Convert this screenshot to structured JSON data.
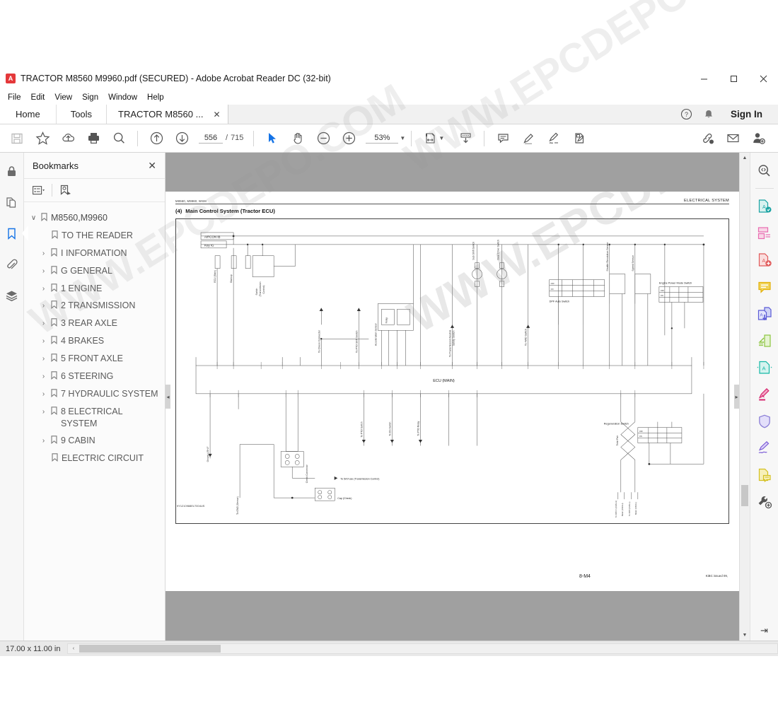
{
  "window": {
    "title": "TRACTOR M8560 M9960.pdf (SECURED) - Adobe Acrobat Reader DC (32-bit)",
    "app_badge": "A",
    "minimize": "–",
    "maximize": "☐",
    "close": "✕"
  },
  "menu": {
    "items": [
      "File",
      "Edit",
      "View",
      "Sign",
      "Window",
      "Help"
    ]
  },
  "tabs": {
    "home": "Home",
    "tools": "Tools",
    "document": "TRACTOR M8560 ...",
    "close_glyph": "✕",
    "help_icon": "help-circle-icon",
    "bell_icon": "bell-icon",
    "sign_in": "Sign In"
  },
  "toolbar": {
    "save_label": "save-icon",
    "star_label": "add-to-favorites-icon",
    "upload_label": "upload-cloud-icon",
    "print_label": "print-icon",
    "find_label": "find-icon",
    "prev_page": "previous-page-icon",
    "next_page": "next-page-icon",
    "page_current": "556",
    "page_sep": "/",
    "page_total": "715",
    "select_tool": "select-cursor-icon",
    "hand_tool": "hand-icon",
    "zoom_out": "zoom-out-icon",
    "zoom_in": "zoom-in-icon",
    "zoom_value": "53%",
    "zoom_caret": "▼",
    "fit_page": "fit-page-icon",
    "fit_caret": "▼",
    "scroll_mode": "scroll-mode-icon",
    "comment": "comment-icon",
    "highlight": "highlight-icon",
    "sign": "sign-icon",
    "fill_sign": "fill-and-sign-icon",
    "share_link": "share-link-icon",
    "email": "email-icon",
    "add_person": "add-person-icon"
  },
  "left_rail": {
    "items": [
      {
        "name": "security-lock-icon",
        "label": "Security"
      },
      {
        "name": "page-thumbnails-icon",
        "label": "Page Thumbnails"
      },
      {
        "name": "bookmarks-icon",
        "label": "Bookmarks",
        "active": true
      },
      {
        "name": "attachments-paperclip-icon",
        "label": "Attachments"
      },
      {
        "name": "layers-icon",
        "label": "Layers"
      }
    ]
  },
  "bookmarks_panel": {
    "title": "Bookmarks",
    "close_glyph": "✕",
    "options_icon": "bookmark-options-icon",
    "options_caret": "▾",
    "new_bookmark_icon": "new-bookmark-icon",
    "items": [
      {
        "label": "M8560,M9960",
        "level": 0,
        "arrow": "∨",
        "expanded": true
      },
      {
        "label": "TO THE READER",
        "level": 1,
        "arrow": ""
      },
      {
        "label": "I INFORMATION",
        "level": 1,
        "arrow": "›"
      },
      {
        "label": "G GENERAL",
        "level": 1,
        "arrow": "›"
      },
      {
        "label": "1 ENGINE",
        "level": 1,
        "arrow": "›"
      },
      {
        "label": "2 TRANSMISSION",
        "level": 1,
        "arrow": "›"
      },
      {
        "label": "3 REAR AXLE",
        "level": 1,
        "arrow": "›"
      },
      {
        "label": "4 BRAKES",
        "level": 1,
        "arrow": "›"
      },
      {
        "label": "5 FRONT AXLE",
        "level": 1,
        "arrow": "›"
      },
      {
        "label": "6 STEERING",
        "level": 1,
        "arrow": "›"
      },
      {
        "label": "7 HYDRAULIC SYSTEM",
        "level": 1,
        "arrow": "›"
      },
      {
        "label": "8 ELECTRICAL SYSTEM",
        "level": 1,
        "arrow": "›"
      },
      {
        "label": "9 CABIN",
        "level": 1,
        "arrow": "›"
      },
      {
        "label": "ELECTRIC CIRCUIT",
        "level": 1,
        "arrow": ""
      }
    ]
  },
  "document_page": {
    "header_left": "M8560, M9960, WSM",
    "header_right": "ELECTRICAL SYSTEM",
    "section_number": "(4)",
    "section_title": "Main Control System (Tractor ECU)",
    "drawing_number": "9Y1210988ELT004US",
    "page_label": "8-M4",
    "issue_note": "KiBC issued 09,",
    "ecu_label": "ECU (MAIN)",
    "top_bus_labels": [
      "AIRCON IB",
      "Key IG"
    ],
    "component_labels": [
      "ECU (Main)",
      "Backup",
      "Switch (Transmission Control)",
      "To Check Connector",
      "To PTO Shift Switch",
      "Acceleration Sensor",
      "Relay",
      "To Transmission Neutral Safety Switch",
      "Sub Shift Switch",
      "Gear Drive Switch",
      "To 4WD Switch",
      "DPF Auto Switch",
      "Shuttle Revolution Sensor",
      "Speed Sensor",
      "Engine Power Mode Switch",
      "Ground 4-RH-F",
      "To GND (Sensor)",
      "Check Connector",
      "To 5A Fuse (Transmission Control)",
      "Cap (Check)",
      "To PTO Switch",
      "To DS Switch",
      "To PTO Relay",
      "Twist Pair",
      "To DPD In (CAN-H)",
      "Meter (CAN-H)",
      "To DPD (CAN-L)",
      "Meter (CAN-L)",
      "Regeneration Switch"
    ],
    "switch_states": [
      "OFF",
      "ON"
    ]
  },
  "status_bar": {
    "dimensions": "17.00 x 11.00 in",
    "left_arrow": "‹",
    "right_arrow": "›"
  },
  "right_rail": {
    "search_icon": "search-document-icon",
    "items": [
      {
        "name": "export-pdf-icon",
        "label": "Export PDF",
        "color": "#1aa3a3"
      },
      {
        "name": "organize-pages-icon",
        "label": "Organize Pages",
        "color": "#e86bb0"
      },
      {
        "name": "create-pdf-icon",
        "label": "Create PDF",
        "color": "#e05a5a"
      },
      {
        "name": "comment-icon",
        "label": "Comment",
        "color": "#e3b007"
      },
      {
        "name": "combine-files-icon",
        "label": "Combine Files",
        "color": "#5b5bd6"
      },
      {
        "name": "compress-pdf-icon",
        "label": "Compress PDF",
        "color": "#8cc63f"
      },
      {
        "name": "edit-pdf-icon",
        "label": "Edit PDF",
        "color": "#14b8a6"
      },
      {
        "name": "redact-icon",
        "label": "Redact",
        "color": "#d6256e"
      },
      {
        "name": "protect-icon",
        "label": "Protect",
        "color": "#8b7fd6"
      },
      {
        "name": "fill-sign-icon",
        "label": "Fill & Sign",
        "color": "#7b5bd6"
      },
      {
        "name": "request-signature-icon",
        "label": "Request Signatures",
        "color": "#d4c020"
      },
      {
        "name": "more-tools-icon",
        "label": "More Tools",
        "color": "#555555"
      }
    ],
    "collapse_glyph": "⇥"
  },
  "watermark": {
    "text": "WWW.EPCDEPO.COM"
  },
  "colors": {
    "accent_blue": "#1473e6",
    "acrobat_red": "#e4383a",
    "page_gray": "#a0a0a0",
    "panel_bg": "#fbfbfb"
  }
}
